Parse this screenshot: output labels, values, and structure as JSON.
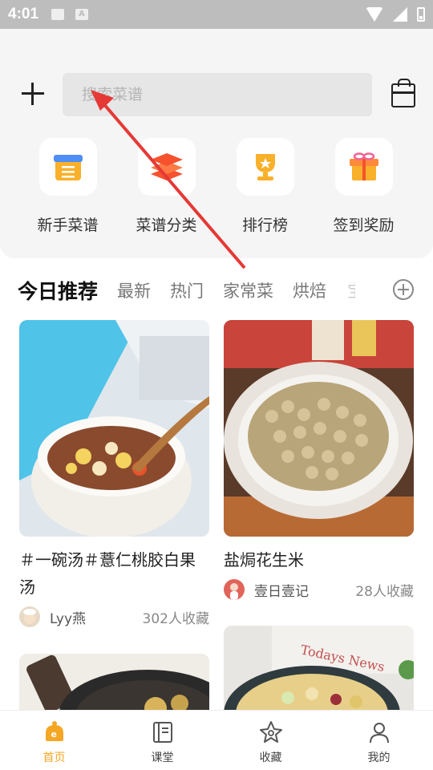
{
  "status_bar": {
    "time": "4:01",
    "a_icon_letter": "A"
  },
  "header": {
    "search_placeholder": "搜索菜谱",
    "categories": [
      {
        "label": "新手菜谱",
        "icon": "notebook-icon",
        "color": "#f9b02a"
      },
      {
        "label": "菜谱分类",
        "icon": "layers-icon",
        "color": "#f5522d"
      },
      {
        "label": "排行榜",
        "icon": "trophy-icon",
        "color": "#f9b02a"
      },
      {
        "label": "签到奖励",
        "icon": "gift-icon",
        "color": "#f9b02a"
      }
    ]
  },
  "tabs": {
    "active": "今日推荐",
    "items": [
      "最新",
      "热门",
      "家常菜",
      "烘焙"
    ],
    "faded": "宝"
  },
  "cards": [
    {
      "title": "＃一碗汤＃薏仁桃胶白果汤",
      "author": "Lyy燕",
      "favorites": "302人收藏"
    },
    {
      "title": "盐焗花生米",
      "author": "壹日壹记",
      "favorites": "28人收藏"
    }
  ],
  "bottom_nav": [
    {
      "label": "首页",
      "icon": "home-icon",
      "active": true
    },
    {
      "label": "课堂",
      "icon": "book-icon",
      "active": false
    },
    {
      "label": "收藏",
      "icon": "star-icon",
      "active": false
    },
    {
      "label": "我的",
      "icon": "person-icon",
      "active": false
    }
  ],
  "colors": {
    "accent": "#f5a623",
    "arrow": "#e53935"
  }
}
